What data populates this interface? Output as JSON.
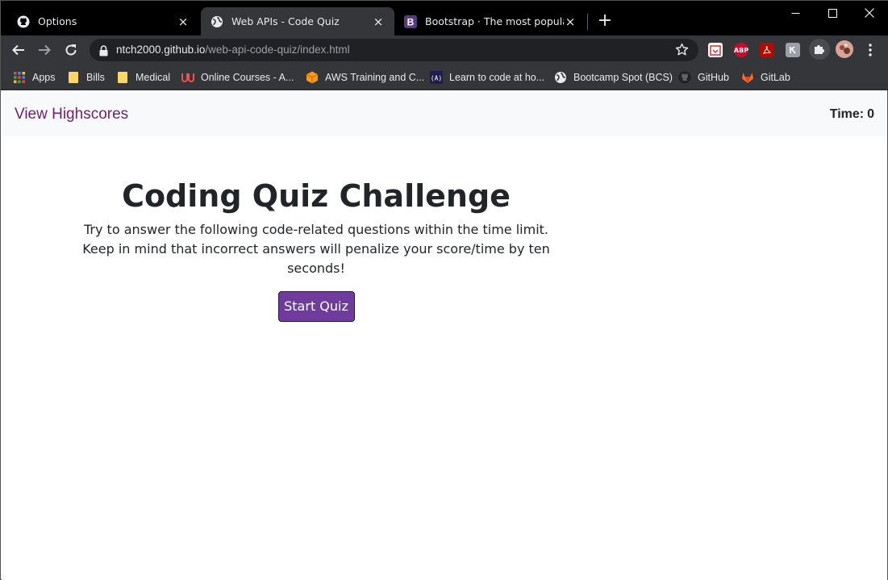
{
  "browser": {
    "tabs": [
      {
        "title": "Options",
        "icon": "github-icon",
        "active": false
      },
      {
        "title": "Web APIs - Code Quiz",
        "icon": "globe-icon",
        "active": true
      },
      {
        "title": "Bootstrap · The most popular HTML",
        "icon": "bootstrap-icon",
        "active": false
      }
    ],
    "new_tab_label": "+",
    "close_glyph": "×",
    "url_host": "ntch2000.github.io",
    "url_path": "/web-api-code-quiz/index.html",
    "bookmarks": [
      {
        "label": "Apps",
        "icon": "apps-grid-icon"
      },
      {
        "label": "Bills",
        "icon": "folder-icon"
      },
      {
        "label": "Medical",
        "icon": "folder-icon"
      },
      {
        "label": "Online Courses - A...",
        "icon": "udemy-icon"
      },
      {
        "label": "AWS Training and C...",
        "icon": "aws-icon"
      },
      {
        "label": "Learn to code at ho...",
        "icon": "codecademy-icon"
      },
      {
        "label": "Bootcamp Spot (BCS)",
        "icon": "globe-icon"
      },
      {
        "label": "GitHub",
        "icon": "github-icon"
      },
      {
        "label": "GitLab",
        "icon": "gitlab-icon"
      }
    ],
    "extensions": [
      {
        "label": "",
        "icon": "calendar-extension-icon"
      },
      {
        "label": "ABP",
        "icon": "adblock-plus-icon"
      },
      {
        "label": "",
        "icon": "pdf-extension-icon"
      },
      {
        "label": "",
        "icon": "grey-extension-icon"
      },
      {
        "label": "",
        "icon": "puzzle-icon"
      },
      {
        "label": "",
        "icon": "profile-avatar"
      }
    ]
  },
  "page": {
    "highscores_link": "View Highscores",
    "timer_label": "Time:",
    "timer_value": "0",
    "title": "Coding Quiz Challenge",
    "description": "Try to answer the following code-related questions within the time limit. Keep in mind that incorrect answers will penalize your score/time by ten seconds!",
    "start_button": "Start Quiz"
  },
  "colors": {
    "link": "#6f1f6f",
    "start_button_bg": "#6f3c9e",
    "navbar_bg": "#f8f9fa",
    "chrome_dark": "#35363a"
  }
}
